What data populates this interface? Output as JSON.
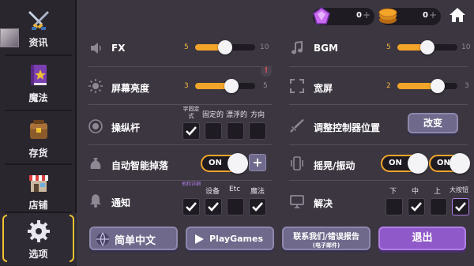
{
  "sidebar": {
    "items": [
      {
        "label": "资讯",
        "icon": "swords-icon"
      },
      {
        "label": "魔法",
        "icon": "spellbook-icon"
      },
      {
        "label": "存货",
        "icon": "backpack-icon"
      },
      {
        "label": "店铺",
        "icon": "shop-icon"
      },
      {
        "label": "选项",
        "icon": "gear-icon",
        "active": true
      }
    ]
  },
  "topbar": {
    "gems": {
      "value": "0",
      "plus": "+",
      "icon": "gem-icon"
    },
    "coins": {
      "value": "0",
      "plus": "+",
      "icon": "coin-icon"
    },
    "home_icon": "home-icon"
  },
  "left": {
    "fx": {
      "label": "FX",
      "min": "5",
      "max": "10",
      "value": 5,
      "range_max": 10
    },
    "brightness": {
      "label": "屏幕亮度",
      "min": "3",
      "max": "5",
      "value": 3,
      "range_max": 5,
      "info": "!"
    },
    "joystick": {
      "label": "操纵杆",
      "columns": [
        "宇固定式",
        "固定的",
        "漂浮的",
        "方向"
      ],
      "checked": [
        true,
        false,
        false,
        false
      ]
    },
    "autoloot": {
      "label": "自动智能掉落",
      "toggle": "ON",
      "plus": "+"
    },
    "notify": {
      "label": "通知",
      "columns": [
        "他和详细",
        "设备",
        "Etc",
        "魔法"
      ],
      "checked": [
        true,
        true,
        false,
        true
      ]
    }
  },
  "right": {
    "bgm": {
      "label": "BGM",
      "min": "5",
      "max": "10",
      "value": 5,
      "range_max": 10
    },
    "widescreen": {
      "label": "宽屏",
      "min": "2",
      "max": "3",
      "value": 2,
      "range_max": 3
    },
    "controller": {
      "label": "调整控制器位置",
      "button": "改变"
    },
    "vibration": {
      "label": "摇晃/振动",
      "toggle1": "ON",
      "toggle2": "ON"
    },
    "resolution": {
      "label": "解决",
      "columns": [
        "下",
        "中",
        "上",
        "大按钮"
      ],
      "checked": [
        false,
        true,
        false,
        true
      ]
    }
  },
  "buttons": {
    "language": "简单中文",
    "playgames": "PlayGames",
    "contact": "联系我们/错误报告",
    "contact_sub": "(电子邮件)",
    "quit": "退出"
  },
  "colors": {
    "accent": "#f3a52a",
    "check_tint_purple": "#b07fe6",
    "bg": "#3b3640"
  }
}
